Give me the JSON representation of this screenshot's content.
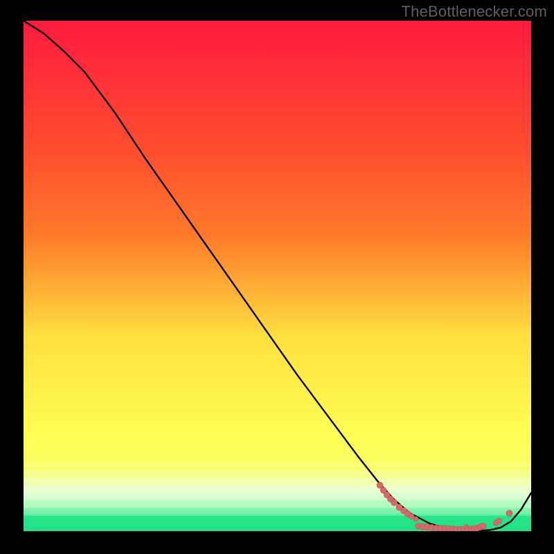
{
  "watermark": "TheBottlenecker.com",
  "colors": {
    "bg": "#000000",
    "watermark": "#5f5f5f",
    "grad_top": "#ff1a3f",
    "grad_mid_upper": "#ff7a2a",
    "grad_mid": "#ffe040",
    "grad_lower_yellow": "#f8ff66",
    "grad_pale": "#f5ffd0",
    "grad_green": "#10e082",
    "line": "#000000",
    "dot_fill": "#d66a6a",
    "dot_stroke": "#c24e4e"
  },
  "chart_data": {
    "type": "line",
    "title": "",
    "xlabel": "",
    "ylabel": "",
    "xlim": [
      0,
      100
    ],
    "ylim": [
      0,
      100
    ],
    "series": [
      {
        "name": "curve",
        "x": [
          0,
          4,
          8,
          12,
          18,
          24,
          30,
          36,
          42,
          48,
          54,
          60,
          66,
          70,
          73,
          76,
          80,
          83,
          86,
          88,
          90,
          92,
          94,
          96,
          98,
          100
        ],
        "y": [
          100,
          97.5,
          94,
          90,
          82,
          73,
          64.5,
          56,
          47.5,
          39,
          30.5,
          22.5,
          14.5,
          9.5,
          6.2,
          3.6,
          1.5,
          0.6,
          0.2,
          0.1,
          0.1,
          0.25,
          0.7,
          1.9,
          4.2,
          7.5
        ]
      }
    ],
    "dots_cluster": {
      "approx_x_range": [
        70,
        95
      ],
      "approx_y_range": [
        0,
        10
      ],
      "points": [
        {
          "x": 70.2,
          "y": 9.0,
          "r": 4.5
        },
        {
          "x": 70.9,
          "y": 8.0,
          "r": 4.5
        },
        {
          "x": 71.6,
          "y": 7.1,
          "r": 4.5
        },
        {
          "x": 72.3,
          "y": 6.3,
          "r": 4.5
        },
        {
          "x": 73.0,
          "y": 5.6,
          "r": 4.5
        },
        {
          "x": 74.0,
          "y": 4.7,
          "r": 4.5
        },
        {
          "x": 74.9,
          "y": 4.0,
          "r": 4.5
        },
        {
          "x": 75.7,
          "y": 3.4,
          "r": 4.5
        },
        {
          "x": 76.4,
          "y": 2.9,
          "r": 4.0
        },
        {
          "x": 77.3,
          "y": 2.4,
          "r": 3.5
        },
        {
          "x": 77.8,
          "y": 1.0,
          "r": 4.5
        },
        {
          "x": 78.6,
          "y": 0.9,
          "r": 4.5
        },
        {
          "x": 79.5,
          "y": 0.8,
          "r": 4.5
        },
        {
          "x": 80.4,
          "y": 0.7,
          "r": 4.5
        },
        {
          "x": 81.3,
          "y": 0.6,
          "r": 4.5
        },
        {
          "x": 82.2,
          "y": 0.55,
          "r": 4.5
        },
        {
          "x": 83.0,
          "y": 0.5,
          "r": 4.5
        },
        {
          "x": 83.8,
          "y": 0.45,
          "r": 4.5
        },
        {
          "x": 84.6,
          "y": 0.4,
          "r": 4.5
        },
        {
          "x": 85.3,
          "y": 0.35,
          "r": 4.5
        },
        {
          "x": 86.1,
          "y": 0.3,
          "r": 4.5
        },
        {
          "x": 86.8,
          "y": 0.3,
          "r": 4.5
        },
        {
          "x": 87.2,
          "y": 0.8,
          "r": 3.5
        },
        {
          "x": 87.5,
          "y": 0.3,
          "r": 4.5
        },
        {
          "x": 88.2,
          "y": 0.35,
          "r": 4.5
        },
        {
          "x": 88.8,
          "y": 0.45,
          "r": 4.5
        },
        {
          "x": 89.4,
          "y": 0.6,
          "r": 4.5
        },
        {
          "x": 90.0,
          "y": 0.8,
          "r": 4.5
        },
        {
          "x": 90.5,
          "y": 1.0,
          "r": 4.5
        },
        {
          "x": 93.1,
          "y": 1.6,
          "r": 4.0
        },
        {
          "x": 93.7,
          "y": 2.0,
          "r": 4.0
        },
        {
          "x": 95.7,
          "y": 3.5,
          "r": 4.5
        }
      ]
    }
  }
}
